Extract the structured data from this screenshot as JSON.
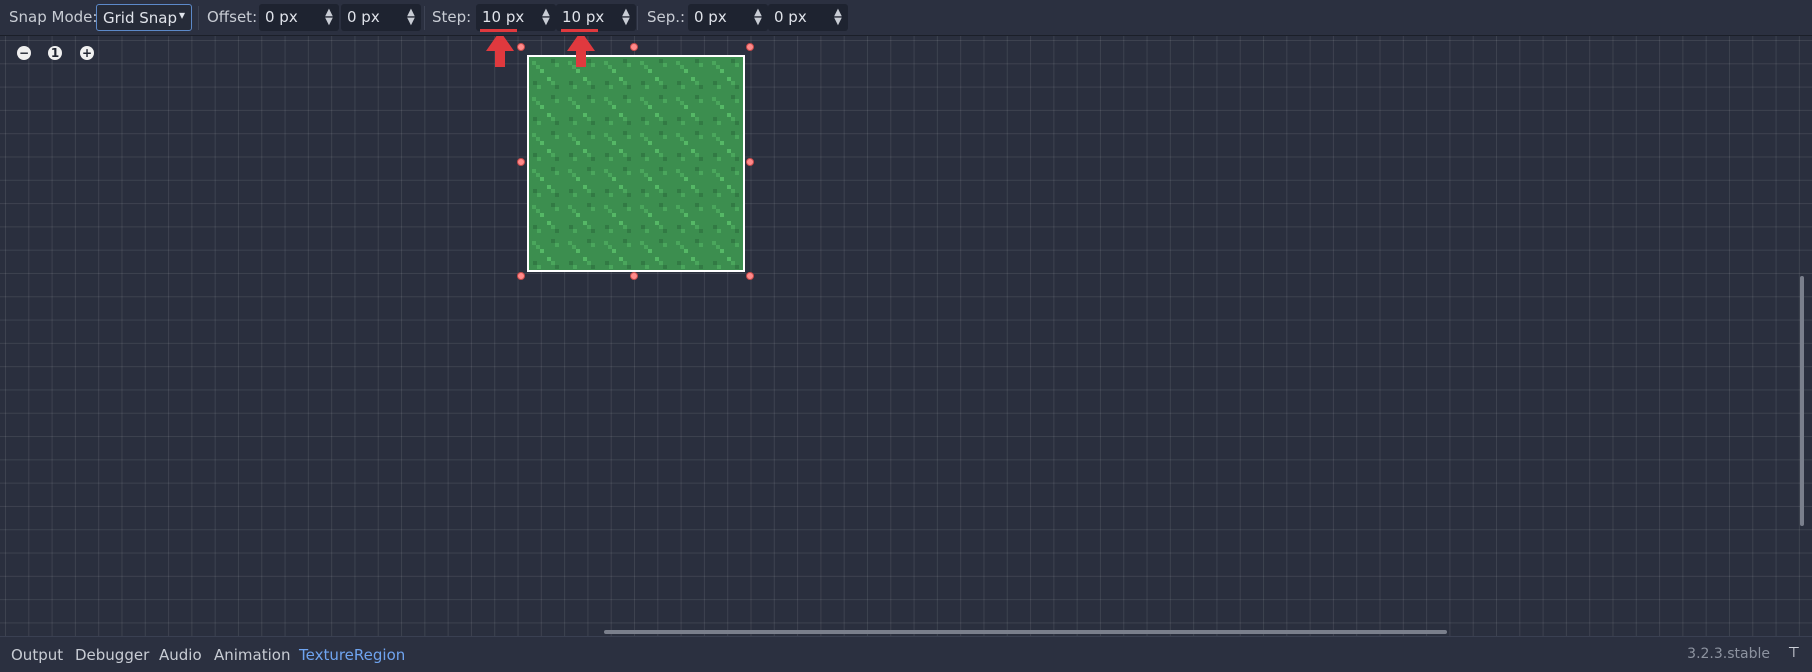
{
  "toolbar": {
    "snap_mode_label": "Snap Mode:",
    "snap_mode_value": "Grid Snap",
    "offset_label": "Offset:",
    "offset_x": "0 px",
    "offset_y": "0 px",
    "step_label": "Step:",
    "step_x": "10 px",
    "step_y": "10 px",
    "sep_label": "Sep.:",
    "sep_x": "0 px",
    "sep_y": "0 px"
  },
  "zoom": {
    "zoom_out": "−",
    "zoom_reset": "1",
    "zoom_in": "+"
  },
  "bottom_tabs": [
    "Output",
    "Debugger",
    "Audio",
    "Animation",
    "TextureRegion"
  ],
  "active_tab": "TextureRegion",
  "version": "3.2.3.stable",
  "colors": {
    "accent": "#5c89c9",
    "active_tab": "#6fa4f0",
    "handle": "#ff8a8a",
    "annotation": "#e0393e",
    "texture_green": "#3c8e4f"
  }
}
